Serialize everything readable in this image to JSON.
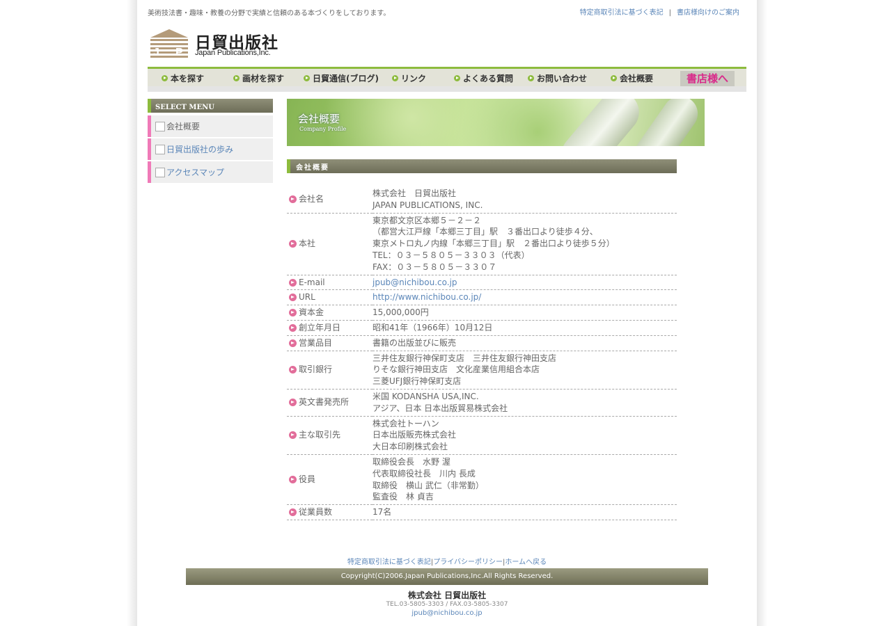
{
  "header": {
    "tagline": "美術技法書・趣味・教養の分野で実績と信頼のある本づくりをしております。",
    "links": [
      "特定商取引法に基づく表記",
      "書店様向けのご案内"
    ],
    "separator": "|"
  },
  "logo": {
    "name_ja": "日貿出版社",
    "name_en": "Japan Publications,Inc."
  },
  "nav": {
    "items": [
      "本を探す",
      "画材を探す",
      "日貿通信(ブログ)",
      "リンク",
      "よくある質問",
      "お問い合わせ",
      "会社概要"
    ],
    "shop": "書店様へ"
  },
  "sidebar": {
    "title": "SELECT MENU",
    "items": [
      "会社概要",
      "日貿出版社の歩み",
      "アクセスマップ"
    ]
  },
  "banner": {
    "title": "会社概要",
    "subtitle": "Company Profile"
  },
  "section": {
    "title": "会社概要"
  },
  "profile": [
    {
      "key": "会社名",
      "lines": [
        "株式会社　日貿出版社",
        "JAPAN PUBLICATIONS, INC."
      ]
    },
    {
      "key": "本社",
      "lines": [
        "東京都文京区本郷５－２－２",
        "（都営大江戸線「本郷三丁目」駅　３番出口より徒歩４分、",
        "東京メトロ丸ノ内線「本郷三丁目」駅　２番出口より徒歩５分）",
        "TEL：０３－５８０５－３３０３（代表）",
        "FAX：０３－５８０５－３３０７"
      ]
    },
    {
      "key": "E-mail",
      "lines": [
        "jpub@nichibou.co.jp"
      ]
    },
    {
      "key": "URL",
      "lines": [
        "http://www.nichibou.co.jp/"
      ]
    },
    {
      "key": "資本金",
      "lines": [
        "15,000,000円"
      ]
    },
    {
      "key": "創立年月日",
      "lines": [
        "昭和41年（1966年）10月12日"
      ]
    },
    {
      "key": "営業品目",
      "lines": [
        "書籍の出版並びに販売"
      ]
    },
    {
      "key": "取引銀行",
      "lines": [
        "三井住友銀行神保町支店　三井住友銀行神田支店",
        "りそな銀行神田支店　文化産業信用組合本店",
        "三菱UFJ銀行神保町支店"
      ]
    },
    {
      "key": "英文書発売所",
      "lines": [
        "米国 KODANSHA USA,INC.",
        "アジア、日本 日本出版貿易株式会社"
      ]
    },
    {
      "key": "主な取引先",
      "lines": [
        "株式会社トーハン",
        "日本出版販売株式会社",
        "大日本印刷株式会社"
      ]
    },
    {
      "key": "役員",
      "lines": [
        "取締役会長　水野 渥",
        "代表取締役社長　川内 長成",
        "取締役　横山 武仁（非常勤）",
        "監査役　林 貞吉"
      ]
    },
    {
      "key": "従業員数",
      "lines": [
        "17名"
      ]
    }
  ],
  "footer": {
    "links": [
      "特定商取引法に基づく表記",
      "プライバシーポリシー",
      "ホームへ戻る"
    ],
    "copyright": "Copyright(C)2006.Japan Publications,Inc.All Rights Reserved.",
    "company": "株式会社  日貿出版社",
    "tel": "TEL.03-5805-3303 / FAX.03-5805-3307",
    "email": "jpub@nichibou.co.jp"
  },
  "colors": {
    "accent_green": "#8dbb3d",
    "accent_pink": "#e26d9a",
    "link_blue": "#5b86b8",
    "header_olive": "#7d7d66"
  }
}
